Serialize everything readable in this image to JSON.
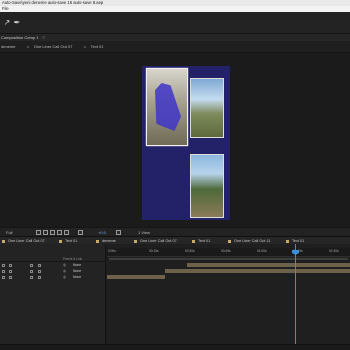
{
  "window": {
    "title": "Auto-Save\\yeni deneme auto-save 16 auto-save 8.aep"
  },
  "menu": {
    "items": [
      "File"
    ]
  },
  "toolbar": {
    "icons": [
      "selection-tool-icon",
      "pen-tool-icon"
    ]
  },
  "composition_panel": {
    "tab_label": "Composition Comp 1",
    "close": "≡"
  },
  "breadcrumbs": [
    "deneme",
    "One Liner Call Out 07",
    "Text 01"
  ],
  "viewer_controls": {
    "zoom": "Full",
    "color_label": "+0.0",
    "layer_label": "1 View"
  },
  "timeline": {
    "tabs": [
      "One Liner Call Out 07",
      "Text 01",
      "deneme",
      "One Liner Call Out 07",
      "Text 01",
      "One Liner Call Out 11",
      "Text 01"
    ],
    "column_headers": {
      "parent_link": "Parent & Link"
    },
    "layers": [
      {
        "parent": "None"
      },
      {
        "parent": "None"
      },
      {
        "parent": "None"
      }
    ],
    "ruler_ticks": [
      "0:00s",
      "00:15s",
      "00:30s",
      "00:45s",
      "01:00s",
      "01:15s",
      "01:30s"
    ],
    "playhead_position": 0.77
  },
  "colors": {
    "comp_background": "#232168",
    "selection_path": "#3f35c8",
    "playhead": "#3a8fd8",
    "layer_bar": "#6e614a"
  }
}
